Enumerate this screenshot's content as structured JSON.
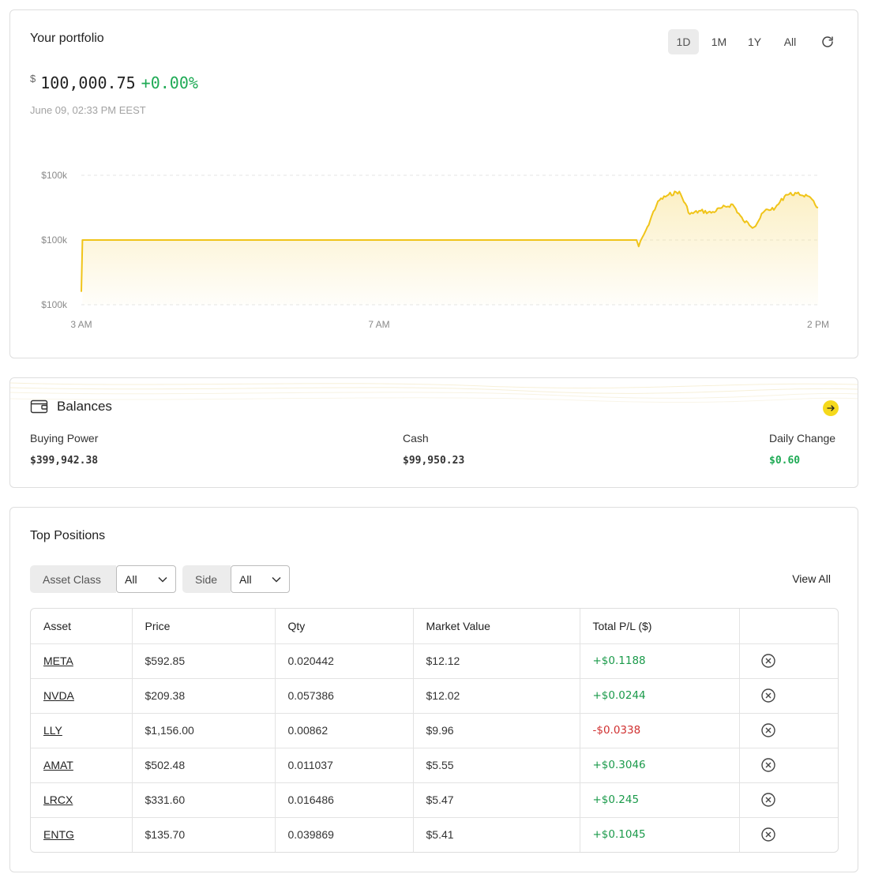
{
  "portfolio": {
    "title": "Your portfolio",
    "currency_symbol": "$",
    "value": "100,000.75",
    "change": "+0.00%",
    "timestamp": "June 09, 02:33 PM EEST",
    "ranges": [
      {
        "label": "1D",
        "active": true
      },
      {
        "label": "1M",
        "active": false
      },
      {
        "label": "1Y",
        "active": false
      },
      {
        "label": "All",
        "active": false
      }
    ],
    "refresh_icon": "refresh-icon"
  },
  "chart_data": {
    "type": "area",
    "series_color": "#f0c419",
    "y_tick_labels": [
      "$100k",
      "$100k",
      "$100k"
    ],
    "x_tick_labels": [
      "3 AM",
      "7 AM",
      "2 PM"
    ],
    "x": [
      "03:00",
      "03:01",
      "11:40",
      "11:42",
      "11:50",
      "12:00",
      "12:10",
      "12:20",
      "12:30",
      "12:40",
      "12:50",
      "13:00",
      "13:10",
      "13:20",
      "13:30",
      "13:40",
      "13:50",
      "14:00",
      "14:10",
      "14:20",
      "14:30"
    ],
    "values": [
      99999.2,
      100000.0,
      100000.0,
      99999.9,
      100000.2,
      100000.6,
      100000.7,
      100000.75,
      100000.4,
      100000.45,
      100000.42,
      100000.5,
      100000.55,
      100000.3,
      100000.2,
      100000.45,
      100000.5,
      100000.7,
      100000.72,
      100000.68,
      100000.5
    ],
    "grid": "horizontal-dashed",
    "legend": "none"
  },
  "balances": {
    "title": "Balances",
    "icon": "wallet-icon",
    "arrow_icon": "arrow-right-icon",
    "buying_power_label": "Buying Power",
    "buying_power": "$399,942.38",
    "cash_label": "Cash",
    "cash": "$99,950.23",
    "daily_change_label": "Daily Change",
    "daily_change": "$0.60"
  },
  "positions": {
    "title": "Top Positions",
    "asset_class_label": "Asset Class",
    "asset_class_value": "All",
    "side_label": "Side",
    "side_value": "All",
    "view_all": "View All",
    "columns": [
      "Asset",
      "Price",
      "Qty",
      "Market Value",
      "Total P/L ($)",
      ""
    ],
    "rows": [
      {
        "asset": "META",
        "price": "$592.85",
        "qty": "0.020442",
        "market_value": "$12.12",
        "pl": "+$0.1188"
      },
      {
        "asset": "NVDA",
        "price": "$209.38",
        "qty": "0.057386",
        "market_value": "$12.02",
        "pl": "+$0.0244"
      },
      {
        "asset": "LLY",
        "price": "$1,156.00",
        "qty": "0.00862",
        "market_value": "$9.96",
        "pl": "-$0.0338"
      },
      {
        "asset": "AMAT",
        "price": "$502.48",
        "qty": "0.011037",
        "market_value": "$5.55",
        "pl": "+$0.3046"
      },
      {
        "asset": "LRCX",
        "price": "$331.60",
        "qty": "0.016486",
        "market_value": "$5.47",
        "pl": "+$0.245"
      },
      {
        "asset": "ENTG",
        "price": "$135.70",
        "qty": "0.039869",
        "market_value": "$5.41",
        "pl": "+$0.1045"
      }
    ]
  },
  "colors": {
    "accent": "#f0c419",
    "positive": "#1a9a4a",
    "negative": "#d03030"
  }
}
